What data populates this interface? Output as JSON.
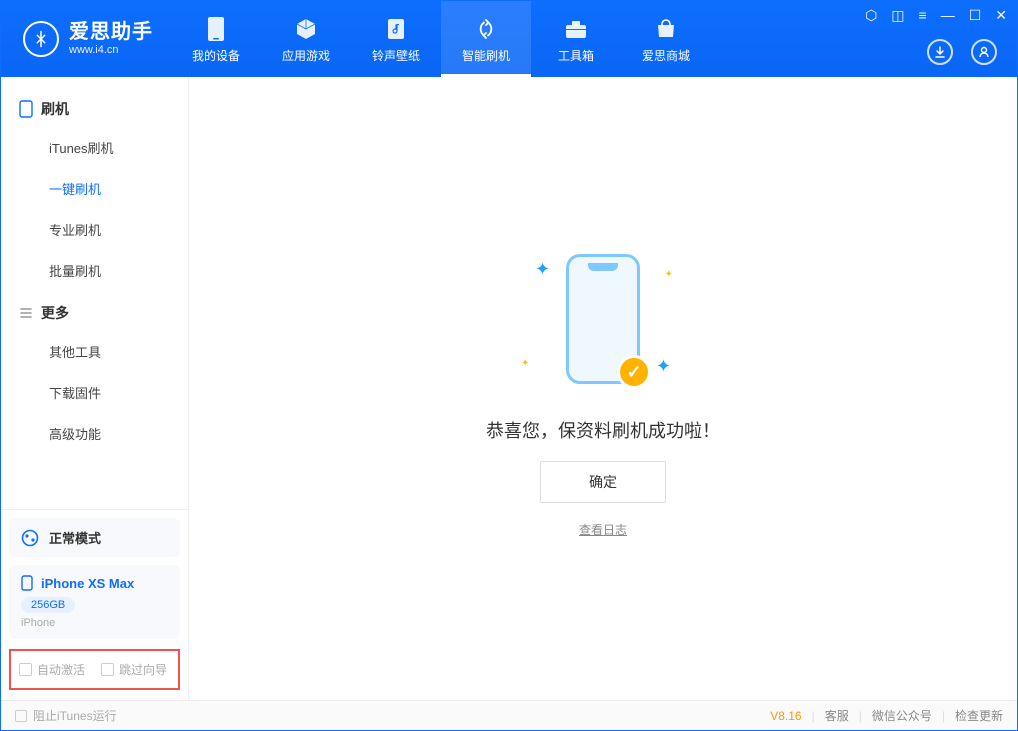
{
  "header": {
    "logo_title": "爱思助手",
    "logo_sub": "www.i4.cn",
    "tabs": [
      {
        "label": "我的设备",
        "icon": "device"
      },
      {
        "label": "应用游戏",
        "icon": "cube"
      },
      {
        "label": "铃声壁纸",
        "icon": "music"
      },
      {
        "label": "智能刷机",
        "icon": "refresh",
        "active": true
      },
      {
        "label": "工具箱",
        "icon": "toolbox"
      },
      {
        "label": "爱思商城",
        "icon": "store"
      }
    ]
  },
  "sidebar": {
    "group1_title": "刷机",
    "group1_items": [
      "iTunes刷机",
      "一键刷机",
      "专业刷机",
      "批量刷机"
    ],
    "group1_active_index": 1,
    "group2_title": "更多",
    "group2_items": [
      "其他工具",
      "下载固件",
      "高级功能"
    ],
    "mode_label": "正常模式",
    "device": {
      "name": "iPhone XS Max",
      "capacity": "256GB",
      "type": "iPhone"
    },
    "bottom_options": {
      "opt1": "自动激活",
      "opt2": "跳过向导"
    }
  },
  "main": {
    "success_text": "恭喜您，保资料刷机成功啦！",
    "ok_button": "确定",
    "log_link": "查看日志"
  },
  "status": {
    "block_itunes": "阻止iTunes运行",
    "version": "V8.16",
    "links": [
      "客服",
      "微信公众号",
      "检查更新"
    ]
  }
}
